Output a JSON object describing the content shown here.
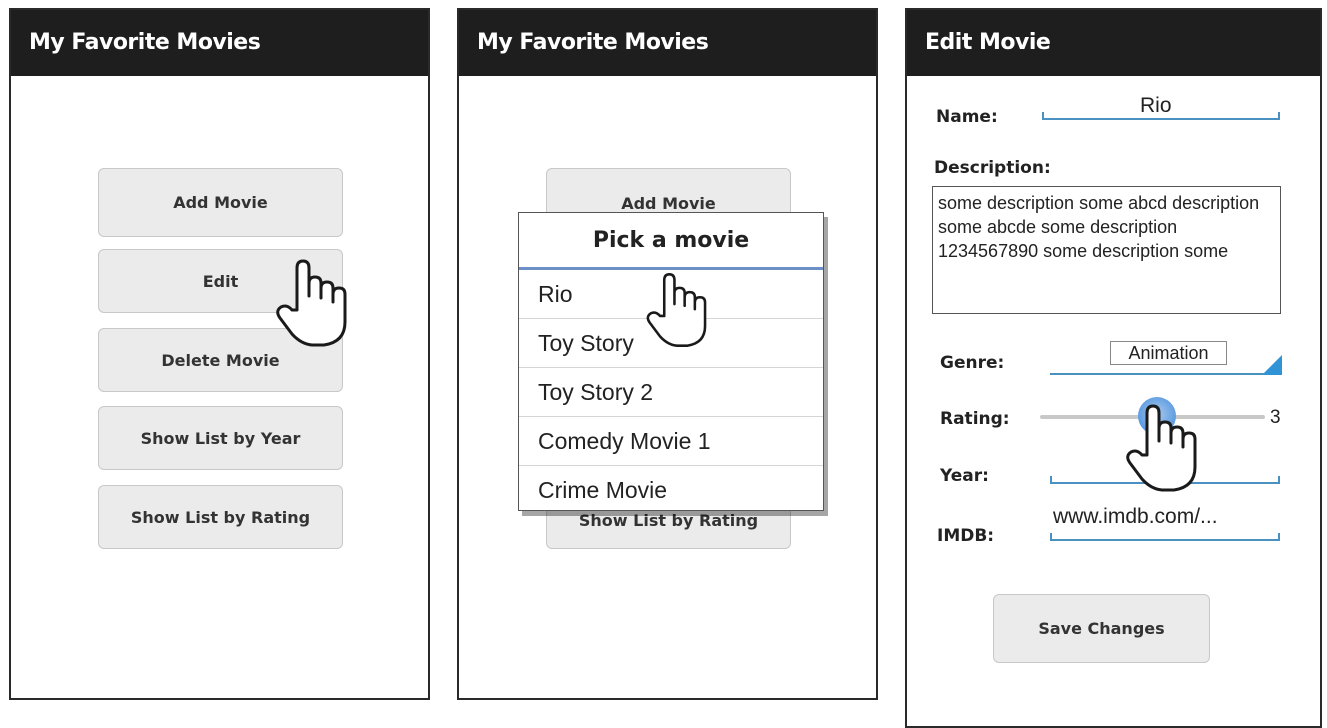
{
  "screen1": {
    "title": "My Favorite Movies",
    "buttons": [
      "Add Movie",
      "Edit",
      "Delete Movie",
      "Show List by Year",
      "Show List by Rating"
    ]
  },
  "screen2": {
    "title": "My Favorite Movies",
    "under_button_top": "Add Movie",
    "under_button_bottom": "Show List by Rating",
    "popup": {
      "title": "Pick a movie",
      "items": [
        "Rio",
        "Toy Story",
        "Toy Story 2",
        "Comedy Movie 1",
        "Crime Movie"
      ]
    }
  },
  "screen3": {
    "title": "Edit Movie",
    "name_label": "Name:",
    "name_value": "Rio",
    "description_label": "Description:",
    "description_value": "some description some abcd description some abcde some description 1234567890 some description some",
    "genre_label": "Genre:",
    "genre_value": "Animation",
    "rating_label": "Rating:",
    "rating_value": "3",
    "year_label": "Year:",
    "year_value": "",
    "imdb_label": "IMDB:",
    "imdb_value": "www.imdb.com/...",
    "save_label": "Save Changes"
  },
  "colors": {
    "titlebar": "#1e1e1e",
    "accent": "#4a90c0",
    "button": "#ebebeb"
  },
  "icons": [
    "hand-pointer-icon",
    "dropdown-triangle-icon",
    "slider-knob"
  ]
}
